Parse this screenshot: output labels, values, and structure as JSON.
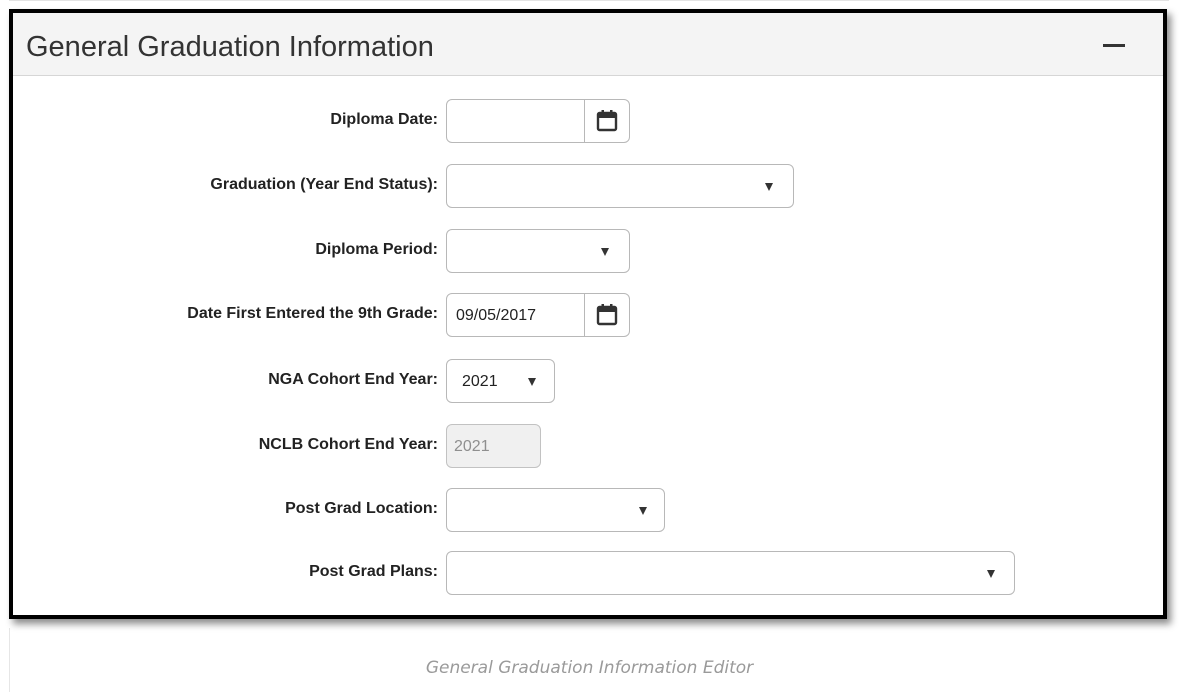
{
  "panel": {
    "title": "General Graduation Information",
    "collapse_icon": "minus-icon"
  },
  "fields": {
    "diploma_date": {
      "label": "Diploma Date:",
      "value": "",
      "icon": "calendar-icon"
    },
    "graduation_status": {
      "label": "Graduation (Year End Status):",
      "value": "",
      "icon": "dropdown-arrow-icon"
    },
    "diploma_period": {
      "label": "Diploma Period:",
      "value": "",
      "icon": "dropdown-arrow-icon"
    },
    "date_first_entered": {
      "label": "Date First Entered the 9th Grade:",
      "value": "09/05/2017",
      "icon": "calendar-icon"
    },
    "nga_cohort_end_year": {
      "label": "NGA Cohort End Year:",
      "value": "2021",
      "icon": "dropdown-arrow-icon"
    },
    "nclb_cohort_end_year": {
      "label": "NCLB Cohort End Year:",
      "value": "2021"
    },
    "post_grad_location": {
      "label": "Post Grad Location:",
      "value": "",
      "icon": "dropdown-arrow-icon"
    },
    "post_grad_plans": {
      "label": "Post Grad Plans:",
      "value": "",
      "icon": "dropdown-arrow-icon"
    }
  },
  "caption": "General Graduation Information Editor",
  "colors": {
    "panel_border": "#000000",
    "header_bg": "#f4f4f4",
    "disabled_bg": "#f0f0f0"
  }
}
